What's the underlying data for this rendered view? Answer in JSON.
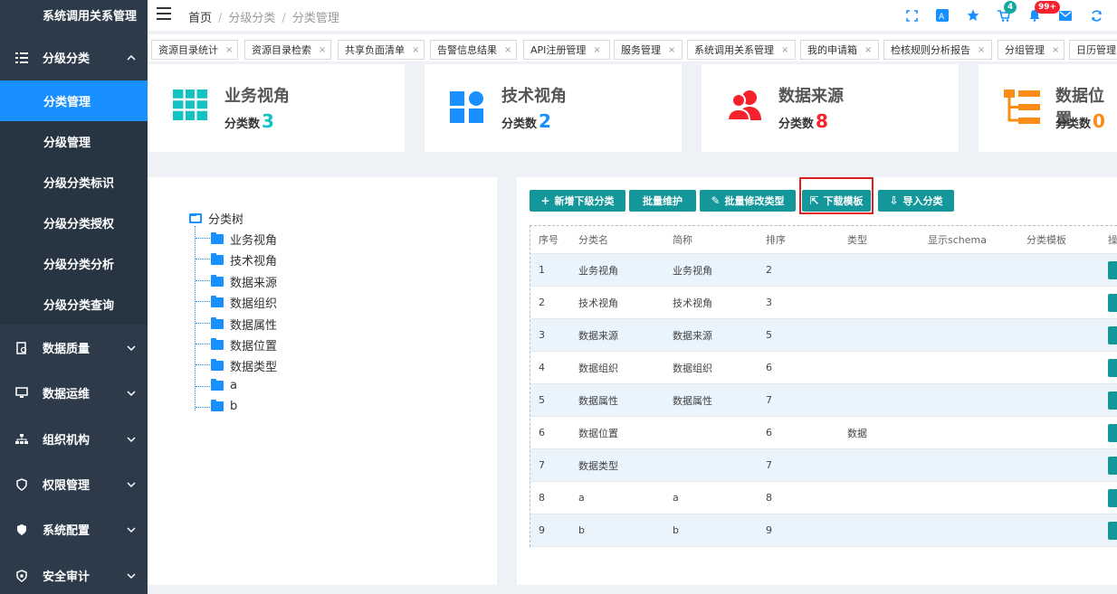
{
  "sidebar": {
    "top_item": "系统调用关系管理",
    "group_classify": "分级分类",
    "sub_items": [
      "分类管理",
      "分级管理",
      "分级分类标识",
      "分级分类授权",
      "分级分类分析",
      "分级分类查询"
    ],
    "groups": [
      "数据质量",
      "数据运维",
      "组织机构",
      "权限管理",
      "系统配置",
      "安全审计"
    ]
  },
  "header": {
    "breadcrumb": [
      "首页",
      "分级分类",
      "分类管理"
    ],
    "cart_badge": "4",
    "bell_badge": "99+"
  },
  "tabs": [
    "资源目录统计",
    "资源目录检索",
    "共享负面清单",
    "告警信息结果",
    "API注册管理",
    "服务管理",
    "系统调用关系管理",
    "我的申请箱",
    "检核规则分析报告",
    "分组管理",
    "日历管理"
  ],
  "cards": [
    {
      "title": "业务视角",
      "label": "分类数",
      "count": "3",
      "color": "#13c2c2"
    },
    {
      "title": "技术视角",
      "label": "分类数",
      "count": "2",
      "color": "#1890ff"
    },
    {
      "title": "数据来源",
      "label": "分类数",
      "count": "8",
      "color": "#f5222d"
    },
    {
      "title": "数据位置",
      "label": "分类数",
      "count": "0",
      "color": "#fa8c16"
    }
  ],
  "tree": {
    "root": "分类树",
    "nodes": [
      "业务视角",
      "技术视角",
      "数据来源",
      "数据组织",
      "数据属性",
      "数据位置",
      "数据类型",
      "a",
      "b"
    ]
  },
  "toolbar": {
    "add_sub": "新增下级分类",
    "batch_maintain": "批量维护",
    "batch_modify": "批量修改类型",
    "download_template": "下载模板",
    "import": "导入分类"
  },
  "table": {
    "headers": [
      "序号",
      "分类名",
      "简称",
      "排序",
      "类型",
      "显示schema",
      "分类模板",
      "操"
    ],
    "rows": [
      [
        "1",
        "业务视角",
        "业务视角",
        "2",
        ""
      ],
      [
        "2",
        "技术视角",
        "技术视角",
        "3",
        ""
      ],
      [
        "3",
        "数据来源",
        "数据来源",
        "5",
        ""
      ],
      [
        "4",
        "数据组织",
        "数据组织",
        "6",
        ""
      ],
      [
        "5",
        "数据属性",
        "数据属性",
        "7",
        ""
      ],
      [
        "6",
        "数据位置",
        "",
        "6",
        "数据"
      ],
      [
        "7",
        "数据类型",
        "",
        "7",
        ""
      ],
      [
        "8",
        "a",
        "a",
        "8",
        ""
      ],
      [
        "9",
        "b",
        "b",
        "9",
        ""
      ]
    ]
  }
}
